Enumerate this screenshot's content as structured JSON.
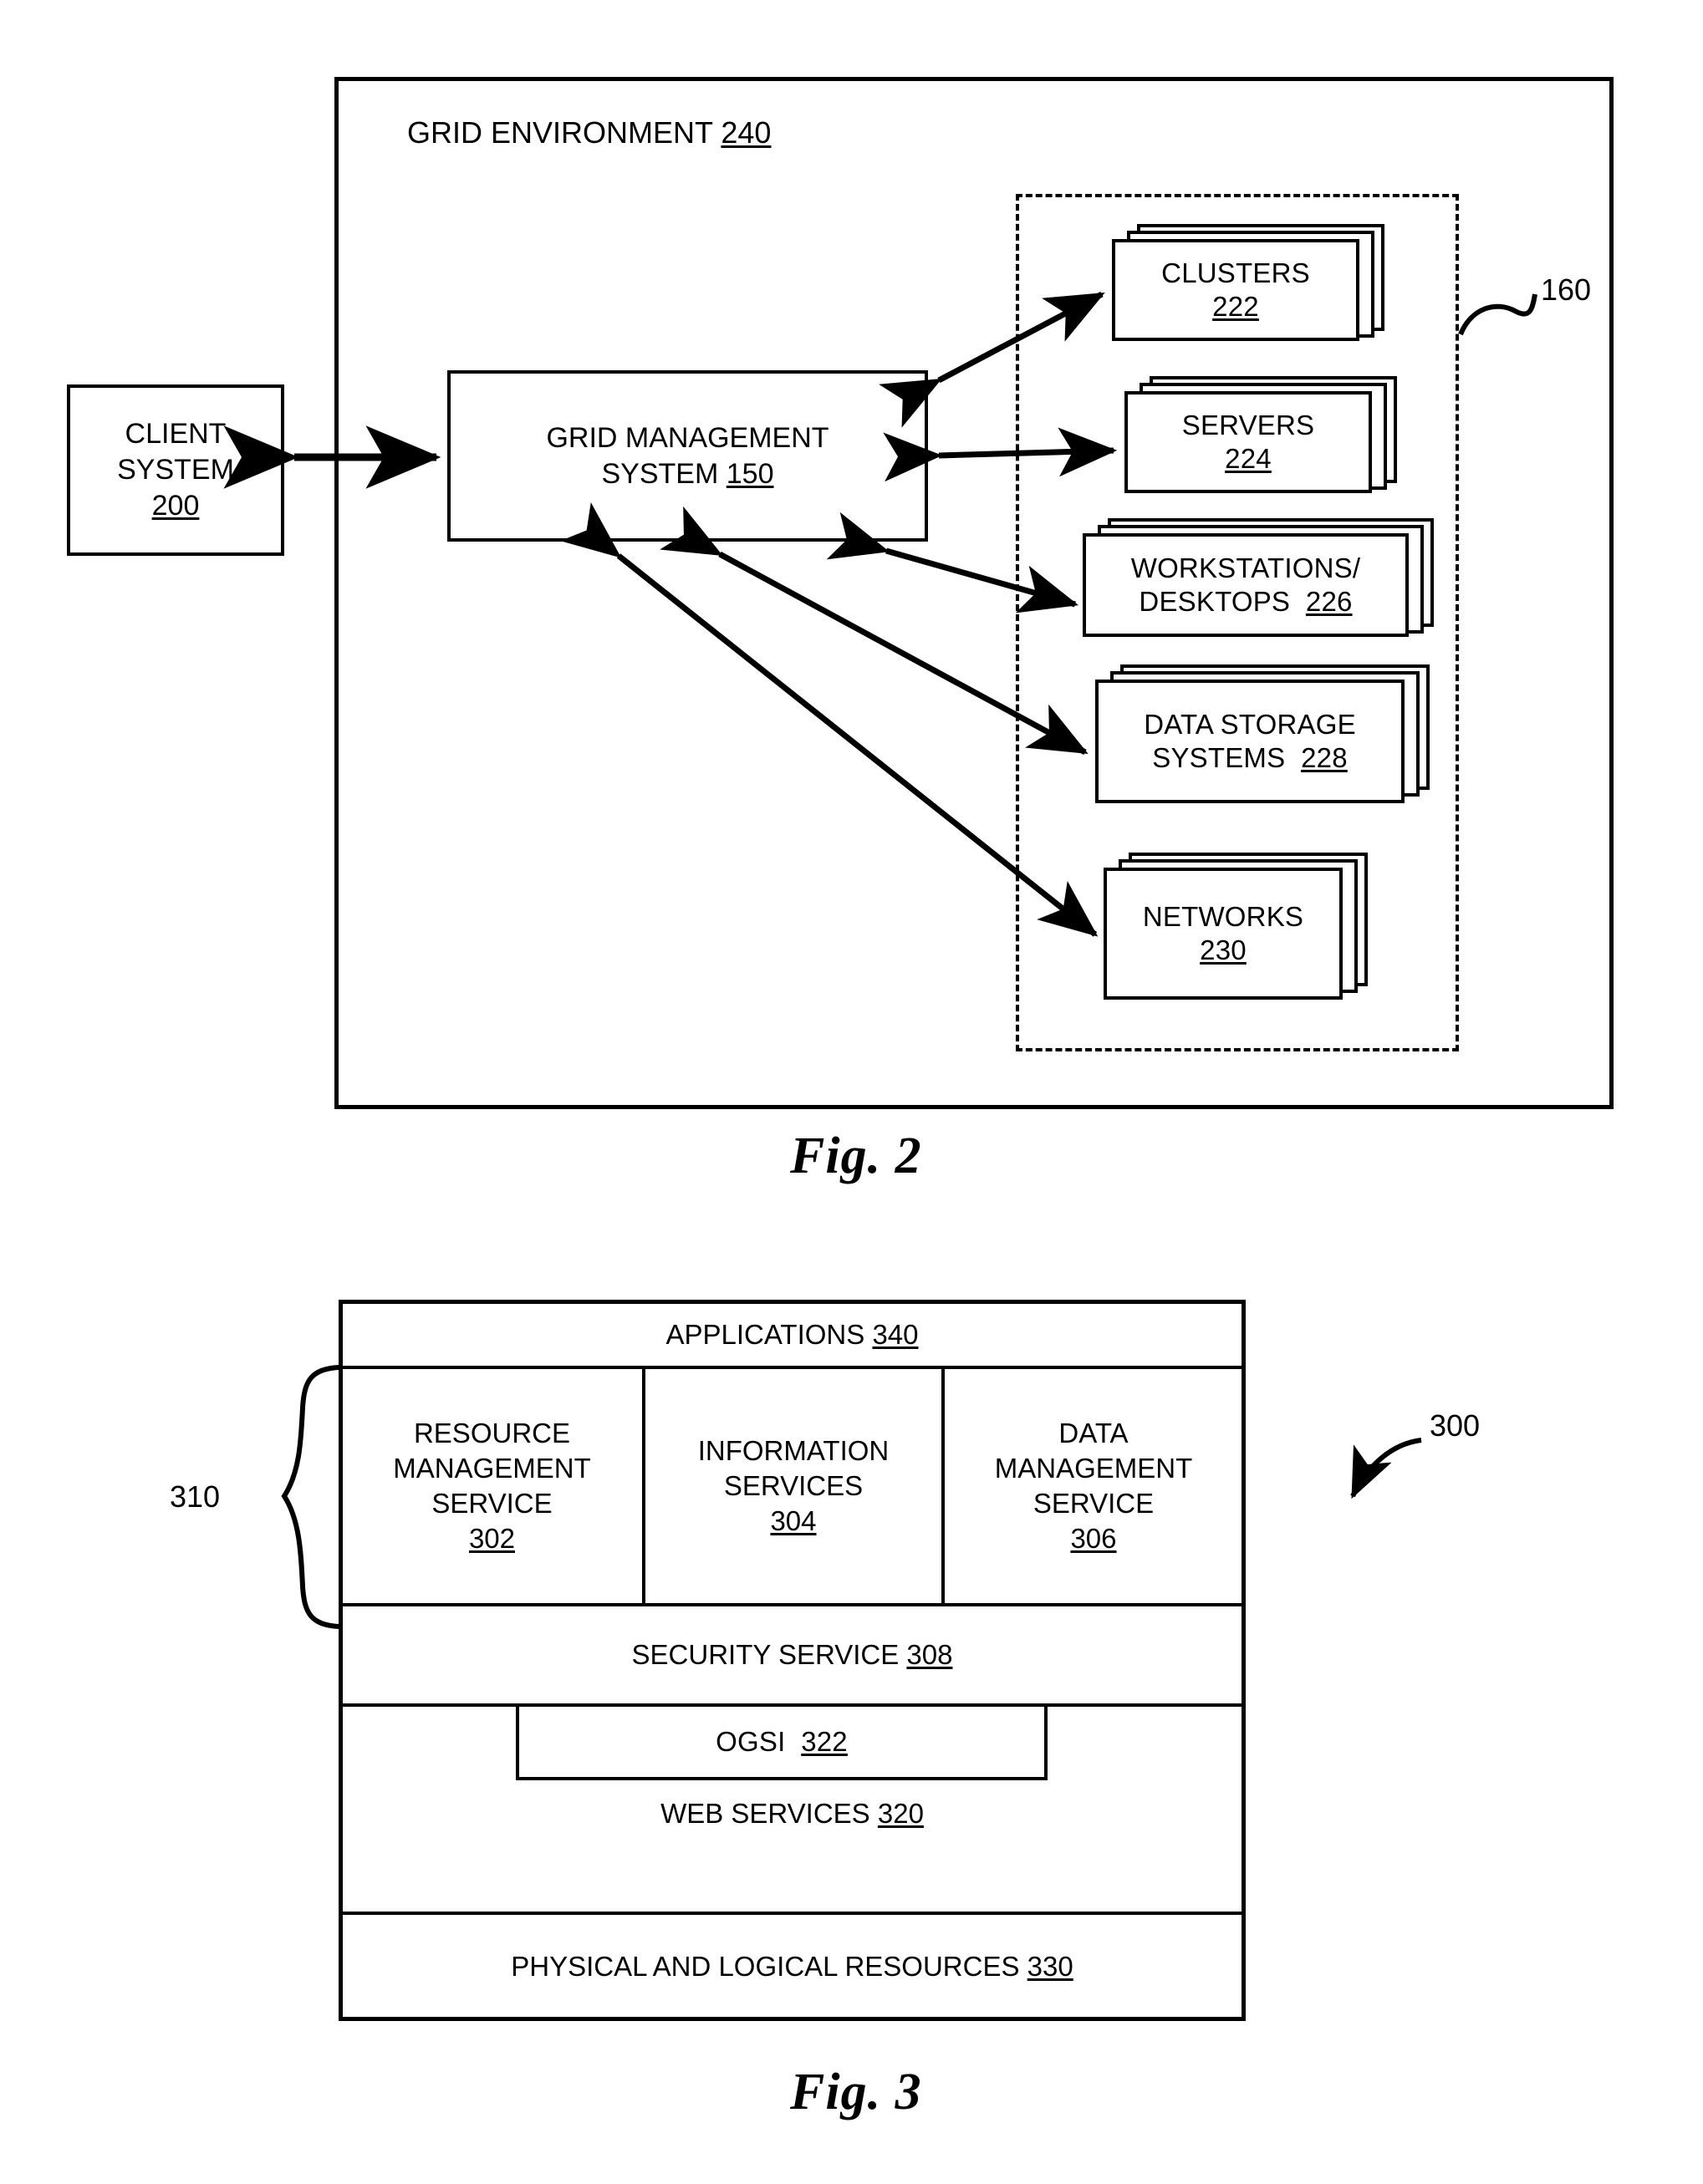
{
  "figure2": {
    "caption": "Fig. 2",
    "environment_label": "GRID ENVIRONMENT",
    "environment_ref": "240",
    "client": {
      "line1": "CLIENT",
      "line2": "SYSTEM",
      "ref": "200"
    },
    "management": {
      "line1": "GRID MANAGEMENT",
      "line2": "SYSTEM",
      "ref": "150"
    },
    "resources_group_ref": "160",
    "resources": [
      {
        "name": "CLUSTERS",
        "ref": "222",
        "lines": 1
      },
      {
        "name": "SERVERS",
        "ref": "224",
        "lines": 1
      },
      {
        "name": "WORKSTATIONS/",
        "name2": "DESKTOPS",
        "ref": "226",
        "lines": 2
      },
      {
        "name": "DATA STORAGE",
        "name2": "SYSTEMS",
        "ref": "228",
        "lines": 2
      },
      {
        "name": "NETWORKS",
        "ref": "230",
        "lines": 1
      }
    ]
  },
  "figure3": {
    "caption": "Fig. 3",
    "stack_ref": "300",
    "brace_ref": "310",
    "applications": {
      "label": "APPLICATIONS",
      "ref": "340"
    },
    "services": [
      {
        "l1": "RESOURCE",
        "l2": "MANAGEMENT",
        "l3": "SERVICE",
        "ref": "302"
      },
      {
        "l1": "INFORMATION",
        "l2": "SERVICES",
        "l3": "",
        "ref": "304"
      },
      {
        "l1": "DATA",
        "l2": "MANAGEMENT",
        "l3": "SERVICE",
        "ref": "306"
      }
    ],
    "security": {
      "label": "SECURITY SERVICE",
      "ref": "308"
    },
    "ogsi": {
      "label": "OGSI",
      "ref": "322"
    },
    "web_services": {
      "label": "WEB SERVICES",
      "ref": "320"
    },
    "physical": {
      "label": "PHYSICAL AND LOGICAL RESOURCES",
      "ref": "330"
    }
  },
  "colors": {
    "ink": "#000000",
    "paper": "#ffffff"
  }
}
